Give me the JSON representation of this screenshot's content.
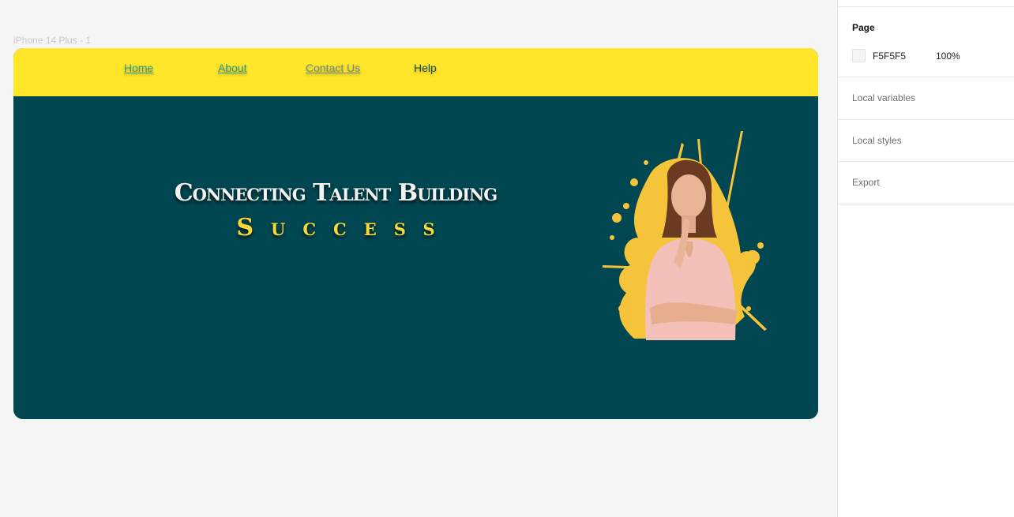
{
  "canvas": {
    "frame_label": "iPhone 14 Plus - 1",
    "background": "#F5F5F5"
  },
  "site": {
    "nav": {
      "background": "#FFE629",
      "links": [
        "Home",
        "About",
        "Contact Us",
        "Help"
      ]
    },
    "hero": {
      "background": "#004751",
      "headline": "Connecting Talent Building",
      "subline": "Success",
      "accent": "#F7D938",
      "image": "woman-portrait-with-yellow-paint-splash"
    }
  },
  "panel": {
    "page_heading": "Page",
    "page_color": "F5F5F5",
    "page_opacity": "100%",
    "sections": [
      "Local variables",
      "Local styles",
      "Export"
    ]
  }
}
